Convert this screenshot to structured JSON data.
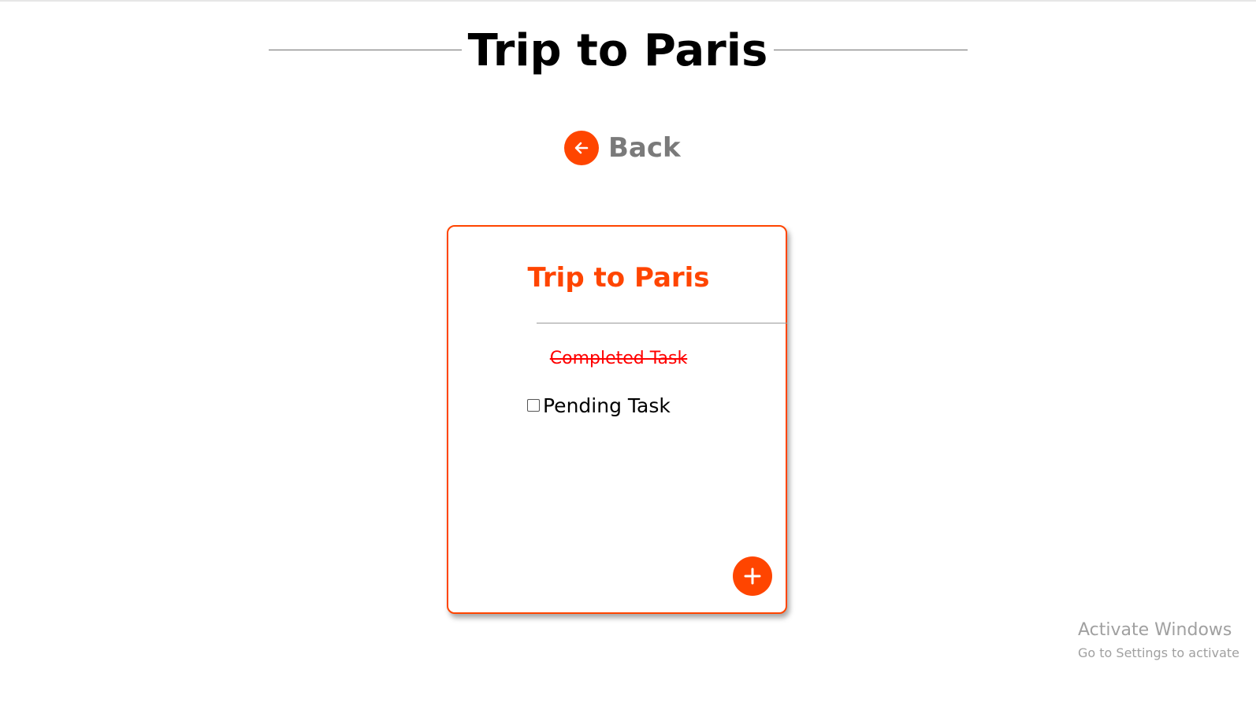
{
  "page": {
    "title": "Trip to Paris"
  },
  "nav": {
    "back_label": "Back",
    "back_icon": "arrow-left-icon"
  },
  "card": {
    "title": "Trip to Paris",
    "tasks": [
      {
        "label": "Completed Task",
        "completed": true
      },
      {
        "label": "Pending Task",
        "completed": false
      }
    ],
    "add_icon": "plus-icon"
  },
  "colors": {
    "accent": "#ff4500",
    "completed_text": "#ff0000",
    "back_text": "#7a7a7a"
  },
  "watermark": {
    "title": "Activate Windows",
    "subtitle": "Go to Settings to activate"
  }
}
